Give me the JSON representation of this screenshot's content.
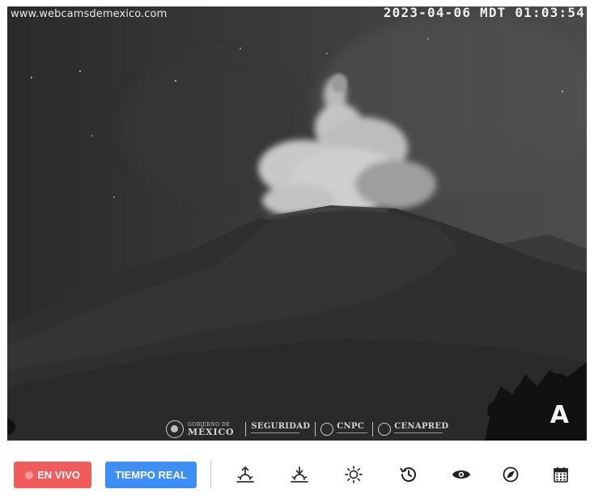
{
  "camera": {
    "site_watermark": "www.webcamsdemexico.com",
    "timestamp": "2023-04-06 MDT 01:03:54",
    "corner_logo": "A"
  },
  "sponsor_logos": {
    "gobierno_small": "GOBIERNO DE",
    "gobierno_big": "MÉXICO",
    "seguridad": "SEGURIDAD",
    "cnpc": "CNPC",
    "cenapred": "CENAPRED"
  },
  "toolbar": {
    "live_label": "EN VIVO",
    "realtime_label": "TIEMPO REAL",
    "live_color": "#f15b5b",
    "realtime_color": "#3e8ef7",
    "icons": [
      {
        "name": "sunrise-icon"
      },
      {
        "name": "sunset-icon"
      },
      {
        "name": "sun-icon"
      },
      {
        "name": "history-icon"
      },
      {
        "name": "eye-icon"
      },
      {
        "name": "compass-icon"
      },
      {
        "name": "calendar-icon"
      }
    ]
  }
}
